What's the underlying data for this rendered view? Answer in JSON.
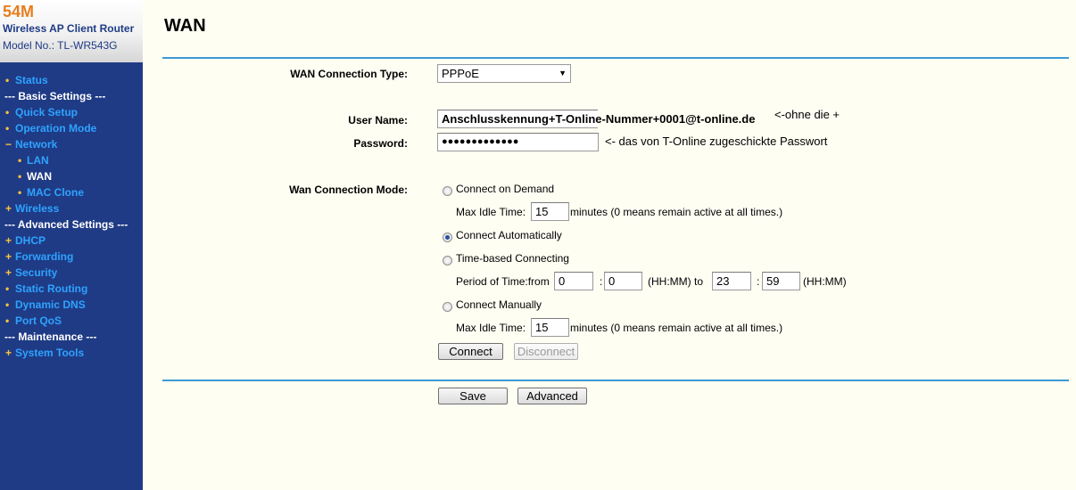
{
  "brand": {
    "model_big": "54M",
    "product": "Wireless AP Client Router",
    "model_no_label": "Model No.:",
    "model_no": "TL-WR543G"
  },
  "menu": [
    {
      "label": "Status",
      "type": "item"
    },
    {
      "label": "--- Basic Settings ---",
      "type": "header"
    },
    {
      "label": "Quick Setup",
      "type": "item"
    },
    {
      "label": "Operation Mode",
      "type": "item"
    },
    {
      "label": "Network",
      "type": "item",
      "bullet": "−"
    },
    {
      "label": "LAN",
      "type": "sub"
    },
    {
      "label": "WAN",
      "type": "sub",
      "active": true
    },
    {
      "label": "MAC Clone",
      "type": "sub"
    },
    {
      "label": "Wireless",
      "type": "item",
      "bullet": "+"
    },
    {
      "label": "--- Advanced Settings ---",
      "type": "header"
    },
    {
      "label": "DHCP",
      "type": "item",
      "bullet": "+"
    },
    {
      "label": "Forwarding",
      "type": "item",
      "bullet": "+"
    },
    {
      "label": "Security",
      "type": "item",
      "bullet": "+"
    },
    {
      "label": "Static Routing",
      "type": "item"
    },
    {
      "label": "Dynamic DNS",
      "type": "item"
    },
    {
      "label": "Port QoS",
      "type": "item"
    },
    {
      "label": "--- Maintenance ---",
      "type": "header"
    },
    {
      "label": "System Tools",
      "type": "item",
      "bullet": "+"
    }
  ],
  "page": {
    "title": "WAN"
  },
  "form": {
    "conn_type_label": "WAN Connection Type:",
    "conn_type_value": "PPPoE",
    "username_label": "User Name:",
    "username_value": "Anschlusskennung+T-Online-Nummer+0001@t-online.de",
    "username_note": "<-ohne die +",
    "password_label": "Password:",
    "password_value": "●●●●●●●●●●●●●",
    "password_note": "<- das von T-Online zugeschickte Passwort",
    "mode_label": "Wan Connection Mode:",
    "opt_demand": "Connect on Demand",
    "max_idle_label": "Max Idle Time:",
    "max_idle_value_1": "15",
    "max_idle_hint": "minutes (0 means remain active at all times.)",
    "opt_auto": "Connect Automatically",
    "opt_time": "Time-based Connecting",
    "period_label": "Period of Time:from",
    "from_h": "0",
    "from_m": "0",
    "colon": ":",
    "hhmm_to": "(HH:MM) to",
    "to_h": "23",
    "to_m": "59",
    "hhmm": "(HH:MM)",
    "opt_manual": "Connect Manually",
    "max_idle_value_2": "15",
    "connect_btn": "Connect",
    "disconnect_btn": "Disconnect",
    "save_btn": "Save",
    "advanced_btn": "Advanced",
    "selected_mode": "Connect Automatically"
  }
}
